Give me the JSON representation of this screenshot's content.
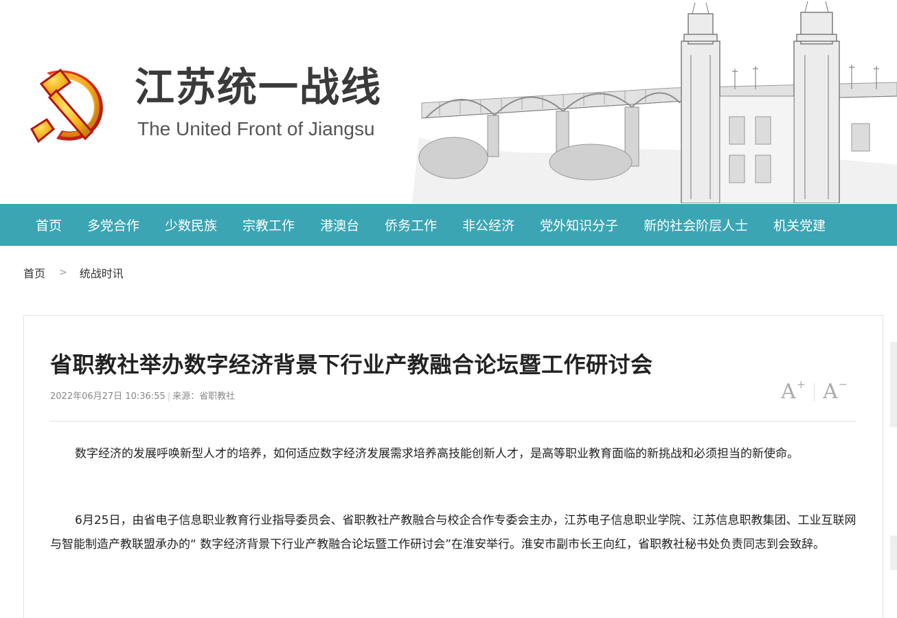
{
  "header": {
    "title": "江苏统一战线",
    "subtitle": "The United Front of Jiangsu"
  },
  "nav": {
    "items": [
      "首页",
      "多党合作",
      "少数民族",
      "宗教工作",
      "港澳台",
      "侨务工作",
      "非公经济",
      "党外知识分子",
      "新的社会阶层人士",
      "机关党建"
    ]
  },
  "breadcrumb": {
    "home": "首页",
    "separator": ">",
    "current": "统战时讯"
  },
  "article": {
    "title": "省职教社举办数字经济背景下行业产教融合论坛暨工作研讨会",
    "date": "2022年06月27日 10:36:55",
    "source": "来源：省职教社",
    "paragraphs": [
      "数字经济的发展呼唤新型人才的培养，如何适应数字经济发展需求培养高技能创新人才，是高等职业教育面临的新挑战和必须担当的新使命。",
      "6月25日，由省电子信息职业教育行业指导委员会、省职教社产教融合与校企合作专委会主办，江苏电子信息职业学院、江苏信息职教集团、工业互联网与智能制造产教联盟承办的“ 数字经济背景下行业产教融合论坛暨工作研讨会”在淮安举行。淮安市副市长王向红，省职教社秘书处负责同志到会致辞。"
    ]
  },
  "font_controls": {
    "increase": "A",
    "increase_sup": "+",
    "decrease": "A",
    "decrease_sup": "−"
  },
  "colors": {
    "nav_bg": "#3ba5b4",
    "emblem_red": "#d6261f",
    "emblem_gold": "#f3b21b"
  },
  "icons": [
    "party-emblem-icon",
    "bridge-illustration",
    "font-increase-icon",
    "font-decrease-icon"
  ]
}
